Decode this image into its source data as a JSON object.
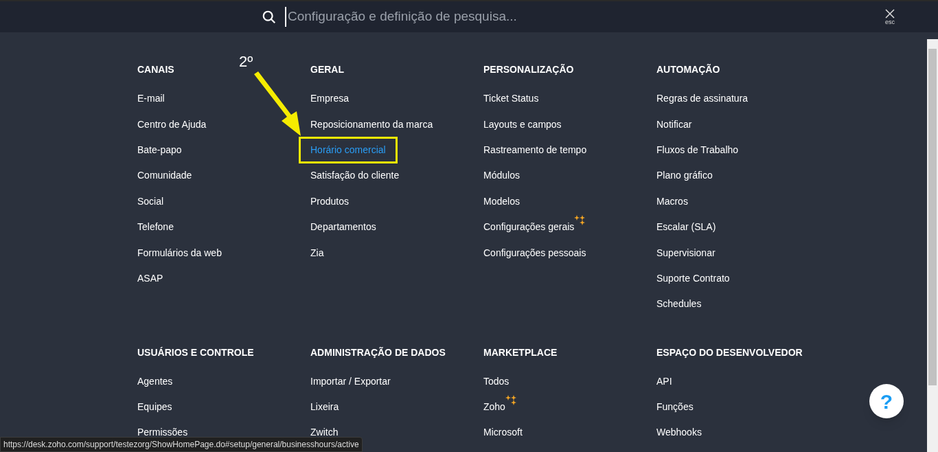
{
  "search": {
    "placeholder": "Configuração e definição de pesquisa..."
  },
  "close": {
    "label": "esc"
  },
  "annotation": {
    "label": "2º"
  },
  "sections": [
    {
      "title": "CANAIS",
      "items": [
        {
          "label": "E-mail",
          "selected": false,
          "sparkle": false
        },
        {
          "label": "Centro de Ajuda",
          "selected": false,
          "sparkle": false
        },
        {
          "label": "Bate-papo",
          "selected": false,
          "sparkle": false
        },
        {
          "label": "Comunidade",
          "selected": false,
          "sparkle": false
        },
        {
          "label": "Social",
          "selected": false,
          "sparkle": false
        },
        {
          "label": "Telefone",
          "selected": false,
          "sparkle": false
        },
        {
          "label": "Formulários da web",
          "selected": false,
          "sparkle": false
        },
        {
          "label": "ASAP",
          "selected": false,
          "sparkle": false
        }
      ]
    },
    {
      "title": "GERAL",
      "items": [
        {
          "label": "Empresa",
          "selected": false,
          "sparkle": false
        },
        {
          "label": "Reposicionamento da marca",
          "selected": false,
          "sparkle": false
        },
        {
          "label": "Horário comercial",
          "selected": true,
          "sparkle": false
        },
        {
          "label": "Satisfação do cliente",
          "selected": false,
          "sparkle": false
        },
        {
          "label": "Produtos",
          "selected": false,
          "sparkle": false
        },
        {
          "label": "Departamentos",
          "selected": false,
          "sparkle": false
        },
        {
          "label": "Zia",
          "selected": false,
          "sparkle": false
        }
      ]
    },
    {
      "title": "PERSONALIZAÇÃO",
      "items": [
        {
          "label": "Ticket Status",
          "selected": false,
          "sparkle": false
        },
        {
          "label": "Layouts e campos",
          "selected": false,
          "sparkle": false
        },
        {
          "label": "Rastreamento de tempo",
          "selected": false,
          "sparkle": false
        },
        {
          "label": "Módulos",
          "selected": false,
          "sparkle": false
        },
        {
          "label": "Modelos",
          "selected": false,
          "sparkle": false
        },
        {
          "label": "Configurações gerais",
          "selected": false,
          "sparkle": true
        },
        {
          "label": "Configurações pessoais",
          "selected": false,
          "sparkle": false
        }
      ]
    },
    {
      "title": "AUTOMAÇÃO",
      "items": [
        {
          "label": "Regras de assinatura",
          "selected": false,
          "sparkle": false
        },
        {
          "label": "Notificar",
          "selected": false,
          "sparkle": false
        },
        {
          "label": "Fluxos de Trabalho",
          "selected": false,
          "sparkle": false
        },
        {
          "label": "Plano gráfico",
          "selected": false,
          "sparkle": false
        },
        {
          "label": "Macros",
          "selected": false,
          "sparkle": false
        },
        {
          "label": "Escalar (SLA)",
          "selected": false,
          "sparkle": false
        },
        {
          "label": "Supervisionar",
          "selected": false,
          "sparkle": false
        },
        {
          "label": "Suporte Contrato",
          "selected": false,
          "sparkle": false
        },
        {
          "label": "Schedules",
          "selected": false,
          "sparkle": false
        }
      ]
    },
    {
      "title": "USUÁRIOS E CONTROLE",
      "items": [
        {
          "label": "Agentes",
          "selected": false,
          "sparkle": false
        },
        {
          "label": "Equipes",
          "selected": false,
          "sparkle": false
        },
        {
          "label": "Permissões",
          "selected": false,
          "sparkle": false
        }
      ]
    },
    {
      "title": "ADMINISTRAÇÃO DE DADOS",
      "items": [
        {
          "label": "Importar / Exportar",
          "selected": false,
          "sparkle": false
        },
        {
          "label": "Lixeira",
          "selected": false,
          "sparkle": false
        },
        {
          "label": "Zwitch",
          "selected": false,
          "sparkle": false
        }
      ]
    },
    {
      "title": "MARKETPLACE",
      "items": [
        {
          "label": "Todos",
          "selected": false,
          "sparkle": false
        },
        {
          "label": "Zoho",
          "selected": false,
          "sparkle": true
        },
        {
          "label": "Microsoft",
          "selected": false,
          "sparkle": false
        }
      ]
    },
    {
      "title": "ESPAÇO DO DESENVOLVEDOR",
      "items": [
        {
          "label": "API",
          "selected": false,
          "sparkle": false
        },
        {
          "label": "Funções",
          "selected": false,
          "sparkle": false
        },
        {
          "label": "Webhooks",
          "selected": false,
          "sparkle": false
        }
      ]
    }
  ],
  "help": {
    "label": "?"
  },
  "status_url": "https://desk.zoho.com/support/testezorg/ShowHomePage.do#setup/general/businesshours/active"
}
